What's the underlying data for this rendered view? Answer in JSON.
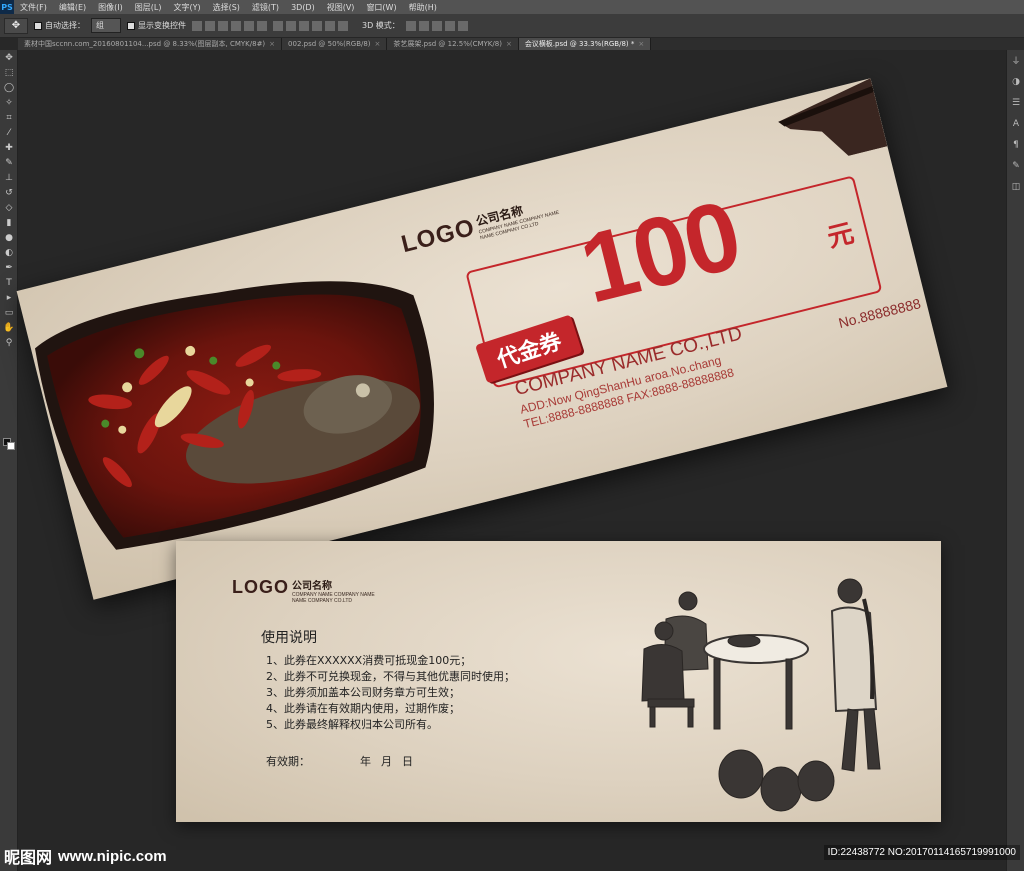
{
  "app": {
    "logo": "PS"
  },
  "menu": [
    "文件(F)",
    "编辑(E)",
    "图像(I)",
    "图层(L)",
    "文字(Y)",
    "选择(S)",
    "滤镜(T)",
    "3D(D)",
    "视图(V)",
    "窗口(W)",
    "帮助(H)"
  ],
  "options": {
    "auto_select_label": "自动选择：",
    "auto_select_value": "组",
    "show_transform_label": "显示变换控件",
    "mode3d_label": "3D 模式："
  },
  "tabs": [
    {
      "label": "素材中国sccnn.com_20160801104...psd @ 8.33%(图层副本, CMYK/8#)"
    },
    {
      "label": "002.psd @ 50%(RGB/8)"
    },
    {
      "label": "茶艺展架.psd @ 12.5%(CMYK/8)"
    },
    {
      "label": "会议横板.psd @ 33.3%(RGB/8) *",
      "active": true
    }
  ],
  "front": {
    "logo": "LOGO",
    "company_cn": "公司名称",
    "company_en_1": "COMPANY NAME COMPANY NAME",
    "company_en_2": "NAME COMPANY CO.LTD",
    "badge": "代金券",
    "amount": "100",
    "unit": "元",
    "company": "COMPANY NAME CO.,LTD",
    "add": "ADD:Now QingShanHu aroa.No.chang",
    "tel_fax": "TEL:8888-8888888  FAX:8888-88888888",
    "serial": "No.88888888"
  },
  "back": {
    "logo": "LOGO",
    "company_cn": "公司名称",
    "company_en_1": "COMPANY NAME COMPANY NAME",
    "company_en_2": "NAME COMPANY CO.LTD",
    "instructions_title": "使用说明",
    "instructions": [
      "1、此券在XXXXXX消费可抵现金100元；",
      "2、此券不可兑换现金，不得与其他优惠同时使用；",
      "3、此券须加盖本公司财务章方可生效；",
      "4、此券请在有效期内使用，过期作废；",
      "5、此券最终解释权归本公司所有。"
    ],
    "validity_label": "有效期：",
    "year": "年",
    "month": "月",
    "day": "日"
  },
  "watermark": {
    "site": "昵图网",
    "url": "www.nipic.com",
    "id": "ID:22438772 NO:20170114165719991000"
  },
  "colors": {
    "accent_red": "#c4262b",
    "ps_bg": "#282828"
  }
}
